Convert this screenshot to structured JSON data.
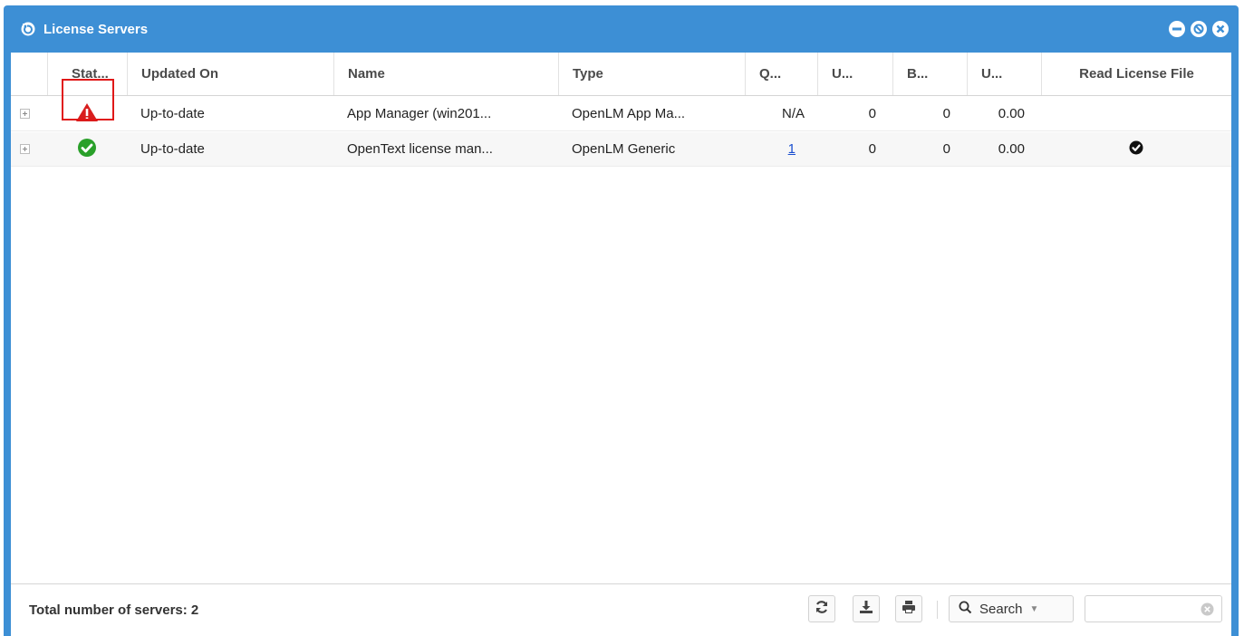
{
  "window": {
    "title": "License Servers",
    "title_icon": "refresh-circle-icon",
    "controls": [
      "minimize-icon",
      "restore-icon",
      "close-icon"
    ]
  },
  "grid": {
    "columns": [
      "Stat...",
      "Updated On",
      "Name",
      "Type",
      "Q...",
      "U...",
      "B...",
      "U...",
      "Read License File"
    ],
    "rows": [
      {
        "status_icon": "warning-icon",
        "updated_on": "Up-to-date",
        "name": "App Manager (win201...",
        "type": "OpenLM App Ma...",
        "q": "N/A",
        "u1": "0",
        "b": "0",
        "u2": "0.00",
        "read_license_file": ""
      },
      {
        "status_icon": "check-circle-icon",
        "updated_on": "Up-to-date",
        "name": "OpenText license man...",
        "type": "OpenLM Generic",
        "q": "1",
        "u1": "0",
        "b": "0",
        "u2": "0.00",
        "read_license_file": "check-icon"
      }
    ]
  },
  "footer": {
    "total_label": "Total number of servers: 2",
    "search_label": "Search",
    "search_value": ""
  },
  "colors": {
    "window_blue": "#3d8fd5",
    "ok_green": "#2aa02a",
    "warning_red": "#d81e1e",
    "link_blue": "#1a4fd0",
    "highlight_red": "#e01818"
  }
}
